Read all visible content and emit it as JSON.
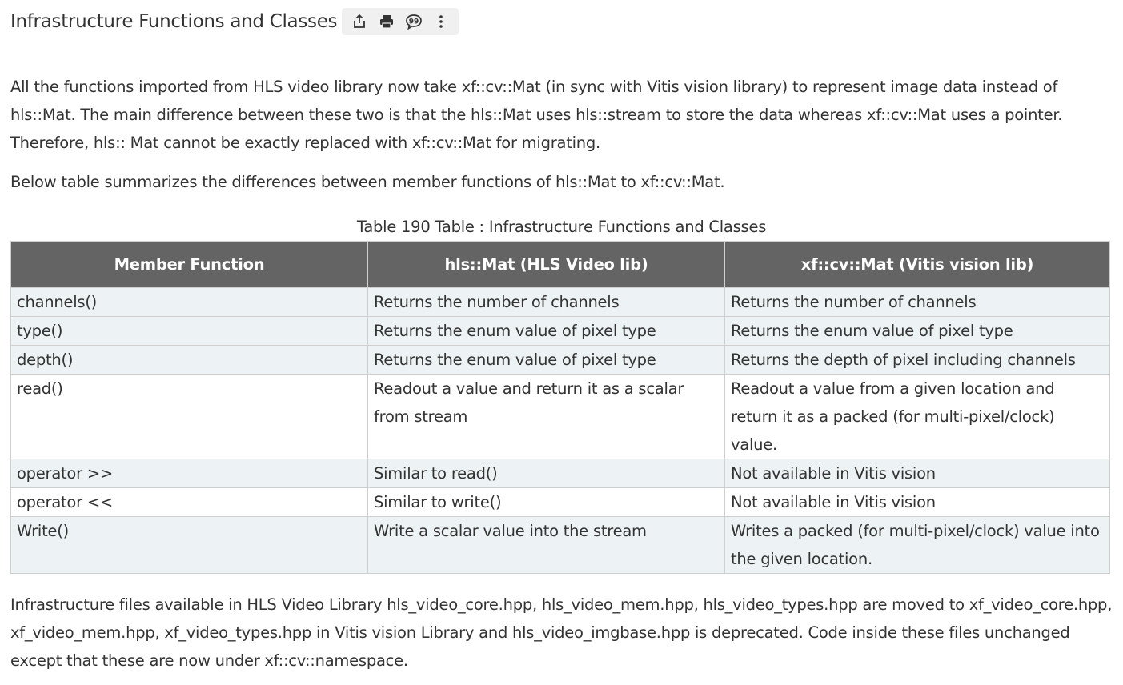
{
  "header": {
    "title": "Infrastructure Functions and Classes",
    "toolbar": [
      {
        "name": "share-icon"
      },
      {
        "name": "print-icon"
      },
      {
        "name": "feedback-icon"
      },
      {
        "name": "more-options-icon"
      }
    ]
  },
  "paragraphs": {
    "intro": "All the functions imported from HLS video library now take xf::cv::Mat (in sync with Vitis vision library) to represent image data instead of hls::Mat. The main difference between these two is that the hls::Mat uses hls::stream to store the data whereas xf::cv::Mat uses a pointer. Therefore, hls:: Mat cannot be exactly replaced with xf::cv::Mat for migrating.",
    "summary": "Below table summarizes the differences between member functions of hls::Mat to xf::cv::Mat.",
    "footer": "Infrastructure files available in HLS Video Library hls_video_core.hpp, hls_video_mem.hpp, hls_video_types.hpp are moved to xf_video_core.hpp, xf_video_mem.hpp, xf_video_types.hpp in Vitis vision Library and hls_video_imgbase.hpp is deprecated. Code inside these files unchanged except that these are now under xf::cv::namespace."
  },
  "table": {
    "caption": "Table 190 Table : Infrastructure Functions and Classes",
    "headers": [
      "Member Function",
      "hls::Mat (HLS Video lib)",
      "xf::cv::Mat (Vitis vision lib)"
    ],
    "rows": [
      [
        "channels()",
        "Returns the number of channels",
        "Returns the number of channels"
      ],
      [
        "type()",
        "Returns the enum value of pixel type",
        "Returns the enum value of pixel type"
      ],
      [
        "depth()",
        "Returns the enum value of pixel type",
        "Returns the depth of pixel including channels"
      ],
      [
        "read()",
        "Readout a value and return it as a scalar from stream",
        "Readout a value from a given location and return it as a packed (for multi-pixel/clock) value."
      ],
      [
        "operator >>",
        "Similar to read()",
        "Not available in Vitis vision"
      ],
      [
        "operator <<",
        "Similar to write()",
        "Not available in Vitis vision"
      ],
      [
        "Write()",
        "Write a scalar value into the stream",
        "Writes a packed (for multi-pixel/clock) value into the given location."
      ]
    ]
  }
}
